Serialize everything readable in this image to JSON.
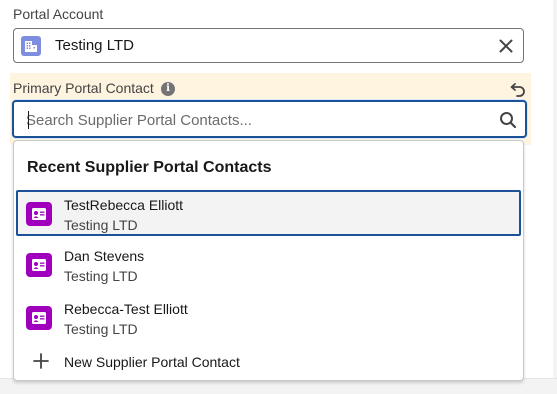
{
  "account_field": {
    "label": "Portal Account",
    "value": "Testing LTD",
    "icon": "account-building-icon",
    "icon_color": "#7f8de1"
  },
  "contact_field": {
    "label": "Primary Portal Contact",
    "info_icon": "info-icon",
    "undo_icon": "undo-icon",
    "search_placeholder": "Search Supplier Portal Contacts...",
    "search_value": "",
    "highlight_color": "#fef4e0",
    "focus_color": "#1b5297"
  },
  "dropdown": {
    "header": "Recent Supplier Portal Contacts",
    "items": [
      {
        "name": "TestRebecca Elliott",
        "account": "Testing LTD",
        "icon": "contact-card-icon",
        "selected": true
      },
      {
        "name": "Dan Stevens",
        "account": "Testing LTD",
        "icon": "contact-card-icon",
        "selected": false
      },
      {
        "name": "Rebecca-Test Elliott",
        "account": "Testing LTD",
        "icon": "contact-card-icon",
        "selected": false
      }
    ],
    "new_action": "New Supplier Portal Contact",
    "contact_icon_color": "#a000bd"
  }
}
